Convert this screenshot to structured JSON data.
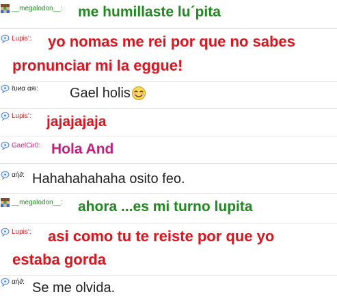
{
  "colors": {
    "green": "#1e8a1e",
    "red": "#e0121b",
    "magenta": "#c81e78",
    "dark": "#222222",
    "separator": "#e6e6e6"
  },
  "messages": [
    {
      "user": "__megalodon__:",
      "user_color": "#1e8a1e",
      "icon": "pixel-avatar-icon",
      "lines": [
        "me humillaste lu´pita"
      ],
      "text_color": "#1e8a1e",
      "bold": true
    },
    {
      "user": "Lupis':",
      "user_color": "#e0121b",
      "icon": "speech-bubble-icon",
      "lines": [
        "yo nomas me rei por que no sabes",
        "pronunciar mi la eggue!"
      ],
      "text_color": "#e0121b",
      "bold": true
    },
    {
      "user": "ℓυиα αяι:",
      "user_color": "#222222",
      "icon": "speech-bubble-icon",
      "lines": [
        "Gael holis"
      ],
      "text_color": "#222222",
      "bold": false,
      "emoji": "smiling-face-icon"
    },
    {
      "user": "Lupis':",
      "user_color": "#e0121b",
      "icon": "speech-bubble-icon",
      "lines": [
        "jajajajaja"
      ],
      "text_color": "#e0121b",
      "bold": true
    },
    {
      "user": "GaelCir0:",
      "user_color": "#c81e78",
      "icon": "speech-bubble-icon",
      "lines": [
        "Hola And"
      ],
      "text_color": "#c81e78",
      "bold": true
    },
    {
      "user": "αή∂:",
      "user_color": "#222222",
      "icon": "speech-bubble-icon",
      "lines": [
        "Hahahahahaha osito feo."
      ],
      "text_color": "#222222",
      "bold": false
    },
    {
      "user": "__megalodon__:",
      "user_color": "#1e8a1e",
      "icon": "pixel-avatar-icon",
      "lines": [
        "ahora ...es mi turno lupita"
      ],
      "text_color": "#1e8a1e",
      "bold": true
    },
    {
      "user": "Lupis':",
      "user_color": "#e0121b",
      "icon": "speech-bubble-icon",
      "lines": [
        "asi como tu te reiste por que yo",
        "estaba gorda"
      ],
      "text_color": "#e0121b",
      "bold": true
    },
    {
      "user": "αή∂:",
      "user_color": "#222222",
      "icon": "speech-bubble-icon",
      "lines": [
        "Se me olvida."
      ],
      "text_color": "#222222",
      "bold": false
    }
  ]
}
